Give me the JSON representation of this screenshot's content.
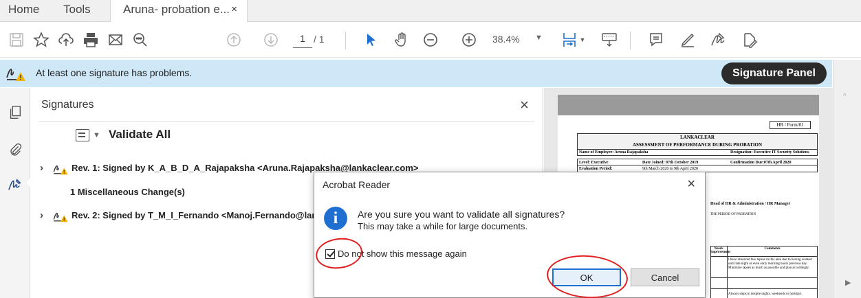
{
  "tabs": {
    "home": "Home",
    "tools": "Tools",
    "document": "Aruna- probation e...",
    "close": "×"
  },
  "toolbar": {
    "page_current": "1",
    "page_total": "/ 1",
    "zoom": "38.4%"
  },
  "signature_bar": {
    "message": "At least one signature has problems.",
    "panel_button": "Signature Panel"
  },
  "signatures_panel": {
    "title": "Signatures",
    "close": "×",
    "validate_all": "Validate All",
    "revisions": [
      {
        "label": "Rev. 1: Signed by K_A_B_D_A_Rajapaksha <Aruna.Rajapaksha@lankaclear.com>"
      },
      {
        "label": "Rev. 2: Signed by T_M_I_Fernando <Manoj.Fernando@lankaclear.com>"
      }
    ],
    "misc_change": "1 Miscellaneous Change(s)"
  },
  "document": {
    "form_no": "HR / Form/01",
    "org": "LANKACLEAR",
    "form_title": "ASSESSMENT OF PERFORMANCE DURING PROBATION",
    "employee": "Name of Employee: Aruna Rajapaksha",
    "designation": "Designation: Executive IT Security Solutions",
    "level": "Level: Executive",
    "date_joined": "Date Joined: 07th October 2019",
    "confirmation_due": "Confirmation Due:07th April 2020",
    "eval_period": "Evaluation Period:",
    "eval_dates": "9th March 2020 to 9th April 2020",
    "hr_sign": "Head of HR & Administration / HR Manager",
    "period_text": "THE PERIOD OF PROBATION",
    "col_needs": "Needs Improvement",
    "col_comments": "Comments",
    "comment1": "I have observed few lapses in this area due to having worked until late night or even early morning hours previous day. Minimize lapses as much as possible and plan accordingly.",
    "comment2": "Always steps in despite nights, weekends or holidays."
  },
  "dialog": {
    "title": "Acrobat Reader",
    "close": "×",
    "line1": "Are you sure you want to validate all signatures?",
    "line2": "This may take a while for large documents.",
    "checkbox_label": "Do not show this message again",
    "checkbox_checked": true,
    "ok": "OK",
    "cancel": "Cancel"
  },
  "colors": {
    "info_bar": "#cfe8f8",
    "accent_blue": "#1f6fd1",
    "annotation_red": "#e02020",
    "warning_yellow": "#f5b400"
  },
  "icons": [
    "save-icon",
    "bookmark-star-icon",
    "upload-cloud-icon",
    "print-icon",
    "email-icon",
    "zoom-search-icon",
    "page-up-icon",
    "page-down-icon",
    "select-arrow-icon",
    "hand-icon",
    "zoom-out-icon",
    "zoom-in-icon",
    "fit-page-icon",
    "keyboard-icon",
    "comment-icon",
    "highlight-pen-icon",
    "sign-icon",
    "fill-sign-icon",
    "pages-icon",
    "attachment-icon",
    "signature-icon",
    "warning-icon",
    "info-icon"
  ]
}
